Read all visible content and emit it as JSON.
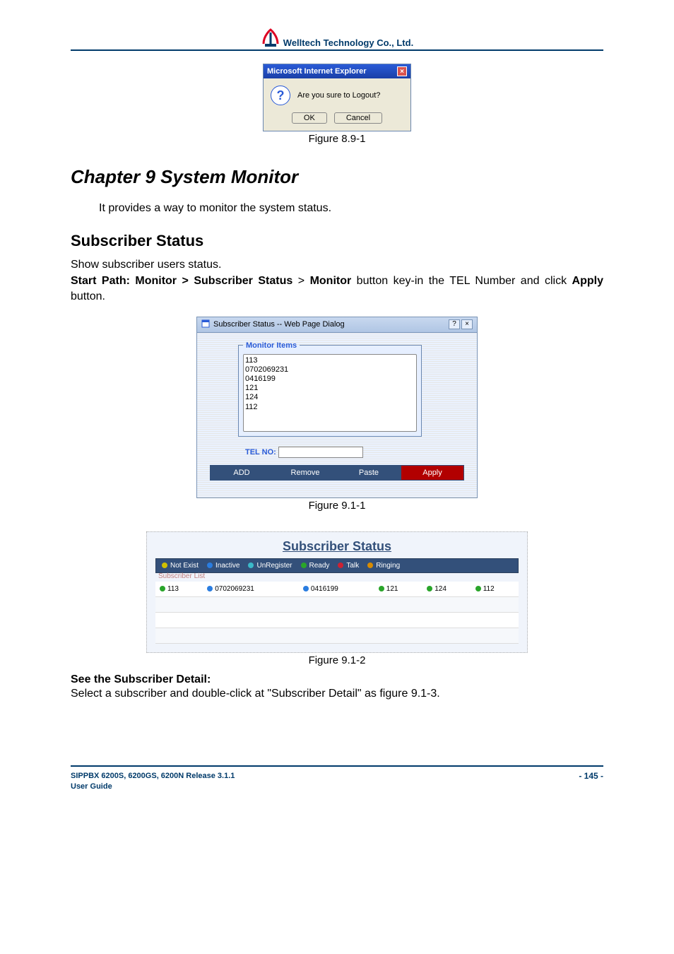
{
  "header": {
    "company": "Welltech Technology Co., Ltd."
  },
  "logout_dialog": {
    "title": "Microsoft Internet Explorer",
    "message": "Are you sure to Logout?",
    "ok": "OK",
    "cancel": "Cancel",
    "caption": "Figure 8.9-1"
  },
  "chapter": {
    "title": "Chapter 9 System Monitor"
  },
  "intro": "It provides a way to monitor the system status.",
  "section": {
    "title": "Subscriber Status"
  },
  "section_desc": "Show subscriber users status.",
  "start_path": {
    "prefix": "Start Path: Monitor > Subscriber Status",
    "gt": ">",
    "monitor": "Monitor",
    "suffix1": " button key-in the TEL Number and click ",
    "apply": "Apply",
    "suffix2": " button."
  },
  "sub_dialog": {
    "title": "Subscriber Status -- Web Page Dialog",
    "group_label": "Monitor Items",
    "items": [
      "113",
      "0702069231",
      "0416199",
      "121",
      "124",
      "112"
    ],
    "tel_label": "TEL NO:",
    "tel_value": "",
    "buttons": {
      "add": "ADD",
      "remove": "Remove",
      "paste": "Paste",
      "apply": "Apply"
    },
    "caption": "Figure 9.1-1"
  },
  "status_panel": {
    "title": "Subscriber Status",
    "legend": [
      {
        "color": "yellow",
        "label": "Not Exist"
      },
      {
        "color": "blue",
        "label": "Inactive"
      },
      {
        "color": "cyan",
        "label": "UnRegister"
      },
      {
        "color": "green",
        "label": "Ready"
      },
      {
        "color": "red",
        "label": "Talk"
      },
      {
        "color": "orange",
        "label": "Ringing"
      }
    ],
    "list_label": "Subscriber List",
    "cells": [
      {
        "color": "green",
        "text": "113"
      },
      {
        "color": "blue",
        "text": "0702069231"
      },
      {
        "color": "blue",
        "text": "0416199"
      },
      {
        "color": "green",
        "text": "121"
      },
      {
        "color": "green",
        "text": "124"
      },
      {
        "color": "green",
        "text": "112"
      }
    ],
    "caption": "Figure 9.1-2"
  },
  "detail": {
    "heading": "See the Subscriber Detail:",
    "text": "Select a subscriber and double-click at \"Subscriber Detail\" as figure 9.1-3."
  },
  "footer": {
    "line1": "SIPPBX 6200S, 6200GS, 6200N Release 3.1.1",
    "line2": "User Guide",
    "page": "- 145 -"
  }
}
